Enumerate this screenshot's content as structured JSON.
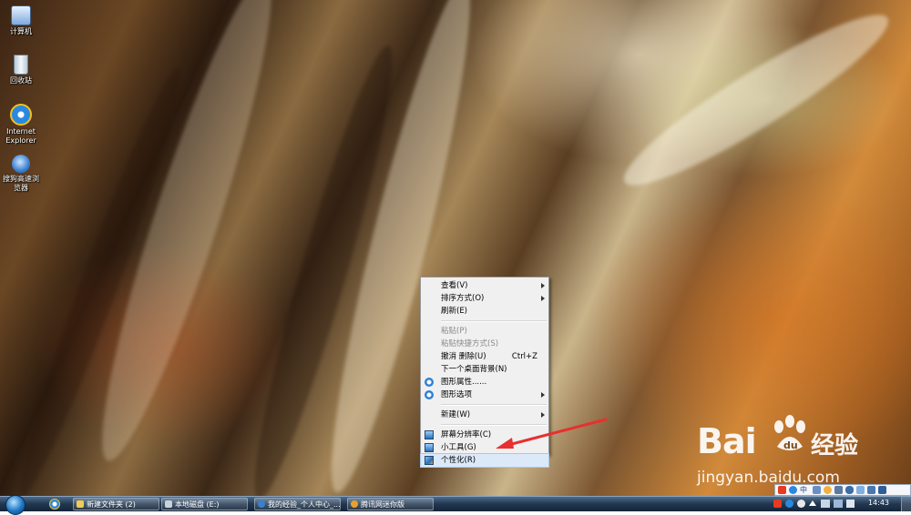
{
  "desktop_icons": [
    {
      "label": "计算机",
      "icon": "computer-icon",
      "color": "#cfe3ff"
    },
    {
      "label": "回收站",
      "icon": "recycle-bin-icon",
      "color": "#d8e6f0"
    },
    {
      "label": "Internet Explorer",
      "icon": "internet-explorer-icon",
      "color": "#2a88e0"
    },
    {
      "label": "搜狗高速浏览器",
      "icon": "sogou-browser-icon",
      "color": "#3a7fd0"
    }
  ],
  "context_menu": {
    "items": [
      {
        "label": "查看(V)",
        "submenu": true
      },
      {
        "label": "排序方式(O)",
        "submenu": true
      },
      {
        "label": "刷新(E)"
      },
      {
        "label": "粘贴(P)",
        "disabled": true
      },
      {
        "label": "粘贴快捷方式(S)",
        "disabled": true
      },
      {
        "label": "撤消 删除(U)",
        "shortcut": "Ctrl+Z"
      },
      {
        "label": "下一个桌面背景(N)"
      },
      {
        "label": "图形属性......",
        "icon": "graphics-properties-icon"
      },
      {
        "label": "图形选项",
        "icon": "graphics-options-icon",
        "submenu": true
      },
      {
        "label": "新建(W)",
        "submenu": true
      },
      {
        "label": "屏幕分辨率(C)",
        "icon": "screen-resolution-icon"
      },
      {
        "label": "小工具(G)",
        "icon": "gadgets-icon"
      },
      {
        "label": "个性化(R)",
        "icon": "personalize-icon",
        "highlighted": true
      }
    ]
  },
  "taskbar": {
    "buttons": [
      {
        "label": "新建文件夹 (2)",
        "icon": "folder-icon"
      },
      {
        "label": "本地磁盘 (E:)",
        "icon": "drive-icon"
      },
      {
        "label": "我的经验_个人中心_...",
        "icon": "sogou-browser-icon"
      },
      {
        "label": "腾讯网迷你版",
        "icon": "qq-icon"
      }
    ],
    "clock": "14:43"
  },
  "ime": {
    "label": "中"
  },
  "watermark": {
    "brand": "Bai",
    "brand_tail": "du",
    "name": "经验",
    "url": "jingyan.baidu.com"
  },
  "colors": {
    "highlight": "#dce9f9",
    "annotation_arrow": "#e83030"
  }
}
